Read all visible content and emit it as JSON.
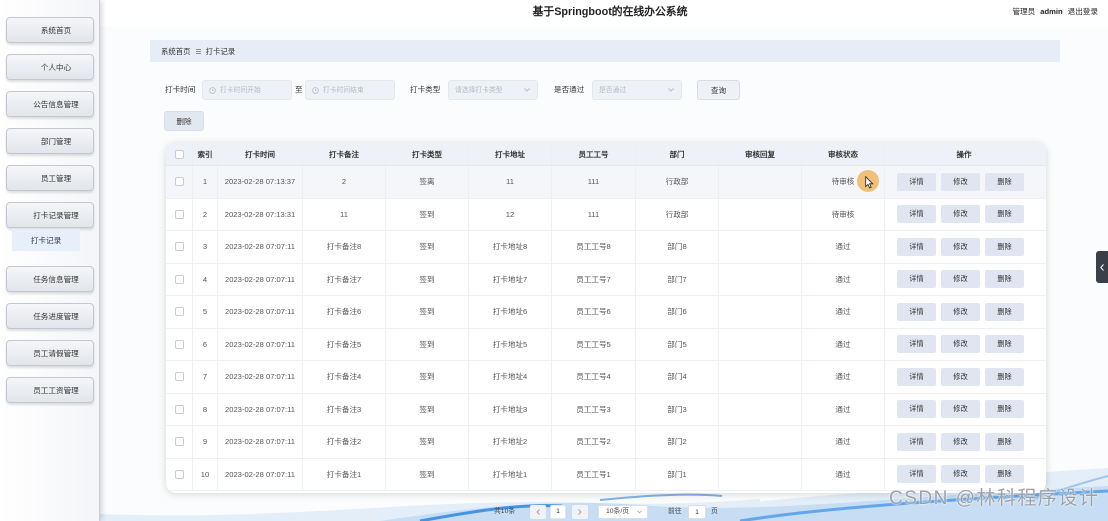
{
  "theme": {
    "page_bg": "#fbfcfd",
    "breadcrumb_bg": "#e6edf6",
    "input_bg": "#eef1f6",
    "table_header_bg": "#eef2f8",
    "row_hover_bg": "#f4f6fa",
    "action_button_bg": "#dfe6f1",
    "sidebar_active_bg": "#e7effa"
  },
  "header": {
    "title": "基于Springboot的在线办公系统",
    "role": "管理员",
    "username": "admin",
    "logout": "退出登录"
  },
  "sidebar": {
    "items": [
      {
        "label": "系统首页"
      },
      {
        "label": "个人中心"
      },
      {
        "label": "公告信息管理"
      },
      {
        "label": "部门管理"
      },
      {
        "label": "员工管理"
      },
      {
        "label": "打卡记录管理",
        "children": [
          {
            "label": "打卡记录"
          }
        ]
      },
      {
        "label": "任务信息管理"
      },
      {
        "label": "任务进度管理"
      },
      {
        "label": "员工请假管理"
      },
      {
        "label": "员工工资管理"
      }
    ]
  },
  "breadcrumb": {
    "items": [
      "系统首页",
      "打卡记录"
    ]
  },
  "search": {
    "time_label": "打卡时间",
    "time_start_placeholder": "打卡时间开始",
    "range_separator": "至",
    "time_end_placeholder": "打卡时间结束",
    "type_label": "打卡类型",
    "type_placeholder": "请选择打卡类型",
    "pass_label": "是否通过",
    "pass_placeholder": "是否通过",
    "query_button": "查询",
    "time_icon": "clock-icon",
    "select_icon": "chevron-down-icon"
  },
  "toolbar": {
    "delete_button": "删除"
  },
  "table": {
    "columns": [
      "索引",
      "打卡时间",
      "打卡备注",
      "打卡类型",
      "打卡地址",
      "员工工号",
      "部门",
      "审核回复",
      "审核状态",
      "操作"
    ],
    "rows": [
      {
        "index": "1",
        "time": "2023-02-28 07:13:37",
        "note": "2",
        "type": "签离",
        "address": "11",
        "emp_no": "111",
        "dept": "行政部",
        "reply": "",
        "status": "待审核"
      },
      {
        "index": "2",
        "time": "2023-02-28 07:13:31",
        "note": "11",
        "type": "签到",
        "address": "12",
        "emp_no": "111",
        "dept": "行政部",
        "reply": "",
        "status": "待审核"
      },
      {
        "index": "3",
        "time": "2023-02-28 07:07:11",
        "note": "打卡备注8",
        "type": "签到",
        "address": "打卡地址8",
        "emp_no": "员工工号8",
        "dept": "部门8",
        "reply": "",
        "status": "通过"
      },
      {
        "index": "4",
        "time": "2023-02-28 07:07:11",
        "note": "打卡备注7",
        "type": "签到",
        "address": "打卡地址7",
        "emp_no": "员工工号7",
        "dept": "部门7",
        "reply": "",
        "status": "通过"
      },
      {
        "index": "5",
        "time": "2023-02-28 07:07:11",
        "note": "打卡备注6",
        "type": "签到",
        "address": "打卡地址6",
        "emp_no": "员工工号6",
        "dept": "部门6",
        "reply": "",
        "status": "通过"
      },
      {
        "index": "6",
        "time": "2023-02-28 07:07:11",
        "note": "打卡备注5",
        "type": "签到",
        "address": "打卡地址5",
        "emp_no": "员工工号5",
        "dept": "部门5",
        "reply": "",
        "status": "通过"
      },
      {
        "index": "7",
        "time": "2023-02-28 07:07:11",
        "note": "打卡备注4",
        "type": "签到",
        "address": "打卡地址4",
        "emp_no": "员工工号4",
        "dept": "部门4",
        "reply": "",
        "status": "通过"
      },
      {
        "index": "8",
        "time": "2023-02-28 07:07:11",
        "note": "打卡备注3",
        "type": "签到",
        "address": "打卡地址3",
        "emp_no": "员工工号3",
        "dept": "部门3",
        "reply": "",
        "status": "通过"
      },
      {
        "index": "9",
        "time": "2023-02-28 07:07:11",
        "note": "打卡备注2",
        "type": "签到",
        "address": "打卡地址2",
        "emp_no": "员工工号2",
        "dept": "部门2",
        "reply": "",
        "status": "通过"
      },
      {
        "index": "10",
        "time": "2023-02-28 07:07:11",
        "note": "打卡备注1",
        "type": "签到",
        "address": "打卡地址1",
        "emp_no": "员工工号1",
        "dept": "部门1",
        "reply": "",
        "status": "通过"
      }
    ],
    "actions": {
      "detail": "详情",
      "edit": "修改",
      "delete": "删除"
    }
  },
  "pagination": {
    "total": "共10条",
    "current_page": "1",
    "page_size": "10条/页",
    "goto_label": "前往",
    "goto_value": "1",
    "page_unit": "页",
    "prev_icon": "chevron-left-icon",
    "next_icon": "chevron-right-icon"
  },
  "edge_tab_icon": "chevron-left-icon",
  "watermark": "CSDN @林科程序设计"
}
